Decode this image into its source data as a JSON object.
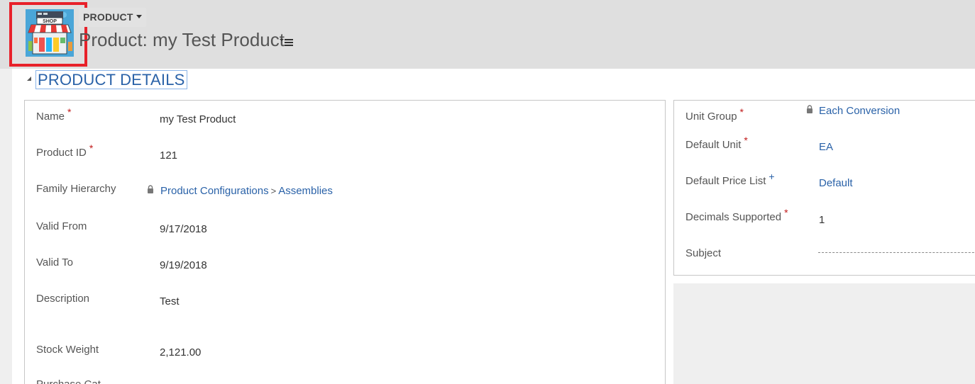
{
  "header": {
    "entity_type": "PRODUCT",
    "record_title": "Product: my Test Product",
    "logo_text": "SHOP"
  },
  "section": {
    "title": "PRODUCT DETAILS"
  },
  "left_fields": [
    {
      "label": "Name",
      "marker": "*",
      "value": "my Test Product"
    },
    {
      "label": "Product ID",
      "marker": "*",
      "value": "121"
    },
    {
      "label": "Family Hierarchy",
      "marker": "",
      "value_links": [
        "Product Configurations",
        "Assemblies"
      ],
      "separator": ">"
    },
    {
      "label": "Valid From",
      "marker": "",
      "value": "9/17/2018"
    },
    {
      "label": "Valid To",
      "marker": "",
      "value": "9/19/2018"
    },
    {
      "label": "Description",
      "marker": "",
      "value": "Test"
    },
    {
      "label": "Stock Weight",
      "marker": "",
      "value": "2,121.00"
    },
    {
      "label": "Purchase Cat",
      "marker": "",
      "value": ""
    }
  ],
  "right_fields": [
    {
      "label": "Unit Group",
      "marker": "*",
      "value": "Each Conversion",
      "is_link": true,
      "locked": true
    },
    {
      "label": "Default Unit",
      "marker": "*",
      "value": "EA",
      "is_link": true
    },
    {
      "label": "Default Price List",
      "marker": "+",
      "value": "Default",
      "is_link": true
    },
    {
      "label": "Decimals Supported",
      "marker": "*",
      "value": "1",
      "is_link": false
    },
    {
      "label": "Subject",
      "marker": "",
      "value": "",
      "is_link": false
    }
  ],
  "colors": {
    "accent": "#2a62a8",
    "required": "#c11b1b",
    "highlight": "#e8212a",
    "header_bg": "#dfdfdf"
  }
}
